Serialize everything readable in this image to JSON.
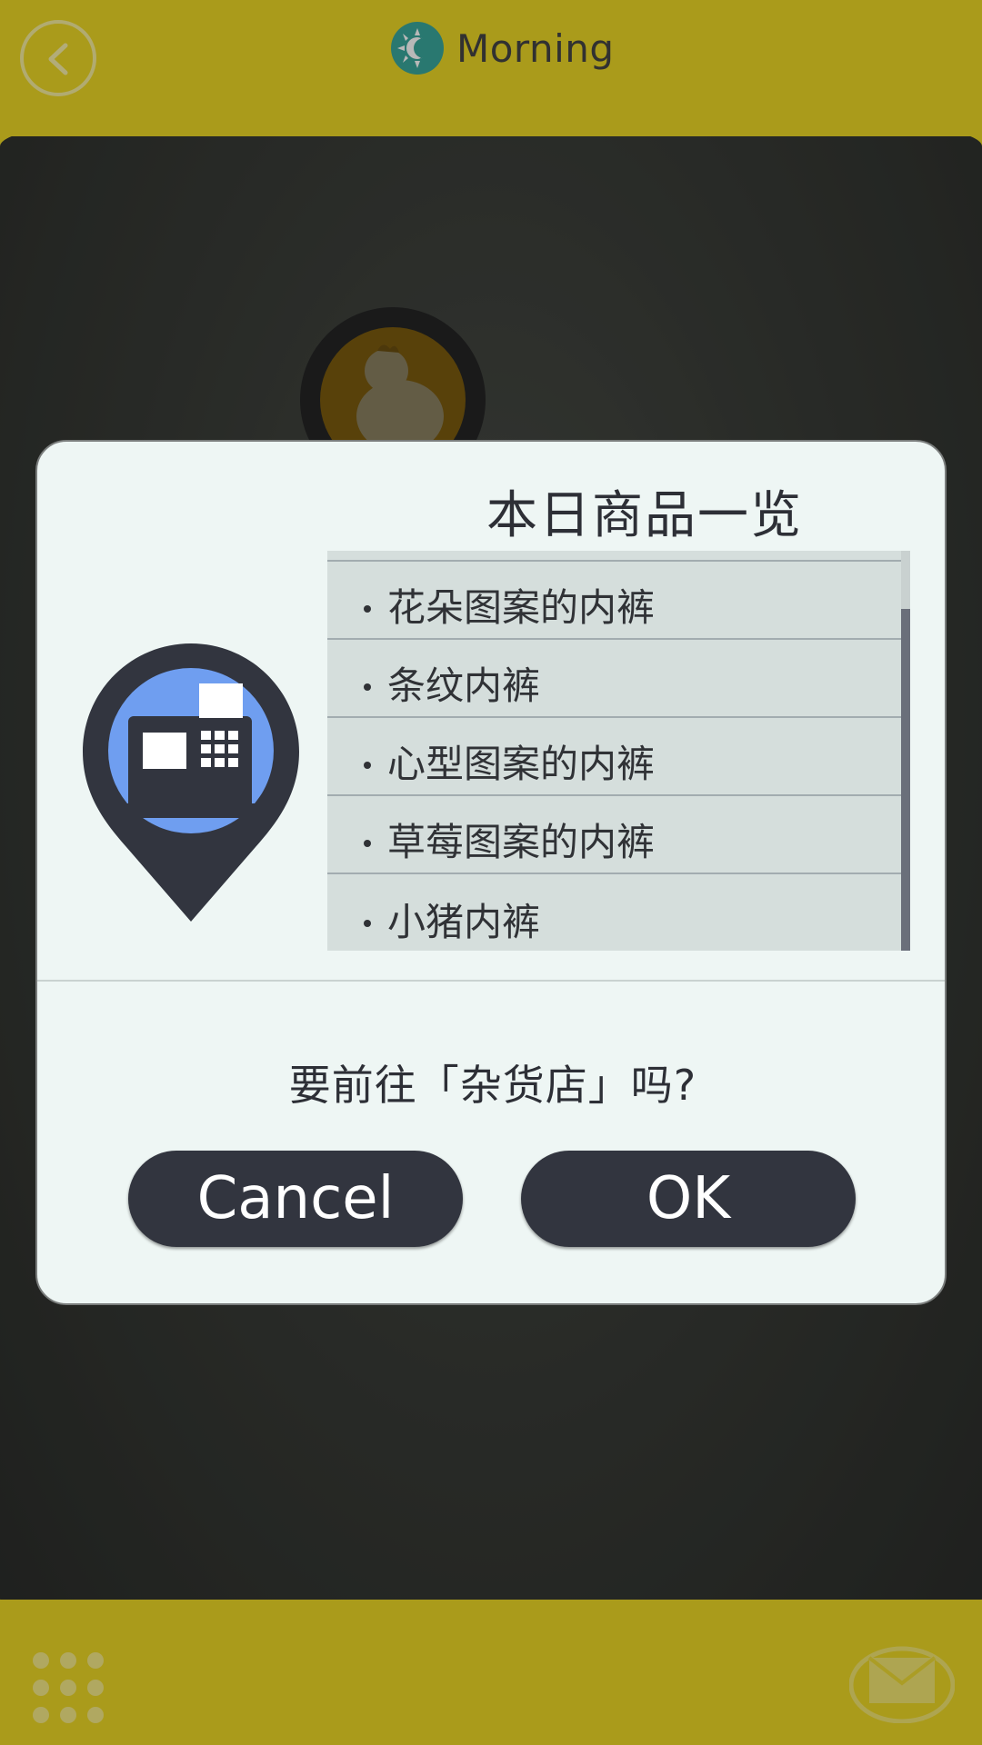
{
  "header": {
    "time_of_day": "Morning"
  },
  "dialog": {
    "title": "本日商品一览",
    "goods": [
      "花朵图案的内裤",
      "条纹内裤",
      "心型图案的内裤",
      "草莓图案的内裤",
      "小猪内裤"
    ],
    "question": "要前往「杂货店」吗?",
    "cancel_label": "Cancel",
    "ok_label": "OK"
  },
  "icons": {
    "back": "back-arrow-icon",
    "time": "sun-icon",
    "location": "cash-register-pin-icon",
    "menu": "grid-menu-icon",
    "mail": "mail-icon"
  },
  "colors": {
    "bar_yellow": "#ecd726",
    "dialog_bg": "#eef6f4",
    "button_dark": "#32353f",
    "pin_dark": "#32353f",
    "pin_blue": "#6f9ef0",
    "sun_teal": "#3aa79b"
  }
}
